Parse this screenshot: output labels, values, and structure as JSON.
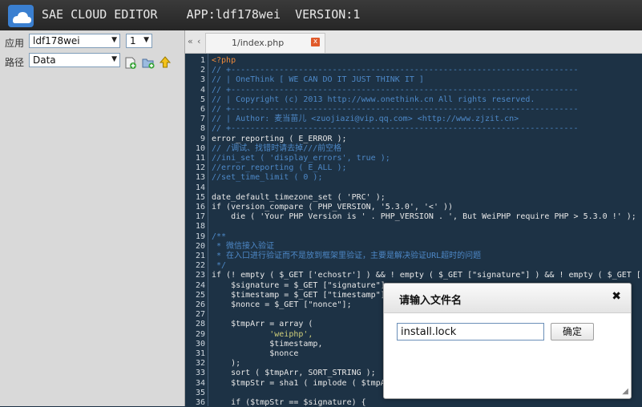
{
  "app": {
    "title": "SAE CLOUD EDITOR    APP:ldf178wei  VERSION:1"
  },
  "left_panel": {
    "app_label": "应用",
    "app_value": "ldf178wei",
    "version_value": "1",
    "path_label": "路径",
    "path_value": "Data",
    "icons": [
      "new-file-icon",
      "new-folder-icon",
      "up-folder-icon"
    ]
  },
  "tabs": {
    "nav_left": "«",
    "nav_right": "‹",
    "active_tab": "1/index.php",
    "close": "x"
  },
  "line_numbers": [
    "1",
    "2",
    "3",
    "4",
    "5",
    "6",
    "7",
    "8",
    "9",
    "10",
    "11",
    "12",
    "13",
    "14",
    "15",
    "16",
    "17",
    "18",
    "19",
    "20",
    "21",
    "22",
    "23",
    "24",
    "25",
    "26",
    "27",
    "28",
    "29",
    "30",
    "31",
    "32",
    "33",
    "34",
    "35",
    "36"
  ],
  "code": [
    "<?php",
    "// +------------------------------------------------------------------------",
    "// | OneThink [ WE CAN DO IT JUST THINK IT ]",
    "// +------------------------------------------------------------------------",
    "// | Copyright (c) 2013 http://www.onethink.cn All rights reserved.",
    "// +------------------------------------------------------------------------",
    "// | Author: 麦当苗儿 <zuojiazi@vip.qq.com> <http://www.zjzit.cn>",
    "// +------------------------------------------------------------------------",
    "error_reporting ( E_ERROR );",
    "// /调试、找错时请去掉///前空格",
    "//ini_set ( 'display_errors', true );",
    "//error_reporting ( E_ALL );",
    "//set_time_limit ( 0 );",
    "",
    "date_default_timezone_set ( 'PRC' );",
    "if (version_compare ( PHP_VERSION, '5.3.0', '<' ))",
    "    die ( 'Your PHP Version is ' . PHP_VERSION . ', But WeiPHP require PHP > 5.3.0 !' );",
    "",
    "/**",
    " * 微信接入验证",
    " * 在入口进行验证而不是放到框架里验证，主要是解决验证URL超时的问题",
    " */",
    "if (! empty ( $_GET ['echostr'] ) && ! empty ( $_GET [\"signature\"] ) && ! empty ( $_GET [\"",
    "    $signature = $_GET [\"signature\"];",
    "    $timestamp = $_GET [\"timestamp\"];",
    "    $nonce = $_GET [\"nonce\"];",
    "",
    "    $tmpArr = array (",
    "            'weiphp',",
    "            $timestamp,",
    "            $nonce",
    "    );",
    "    sort ( $tmpArr, SORT_STRING );",
    "    $tmpStr = sha1 ( implode ( $tmpA",
    "",
    "    if ($tmpStr == $signature) {"
  ],
  "dialog": {
    "title": "请输入文件名",
    "close": "✖",
    "input_value": "install.lock",
    "ok_label": "确定"
  },
  "colors": {
    "editor_bg": "#1d3245",
    "comment": "#4d88c7",
    "keyword": "#ef8a2a",
    "string": "#cfcf7a",
    "topbar": "#2e2e2e"
  }
}
